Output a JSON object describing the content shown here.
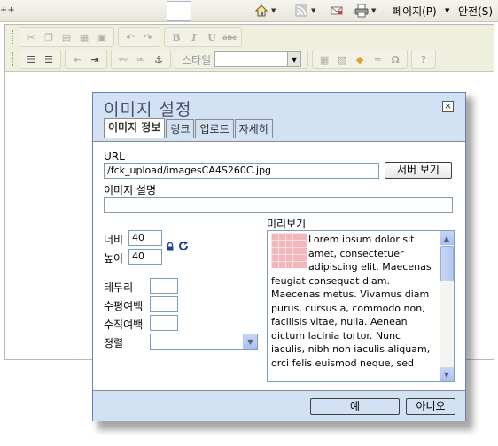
{
  "browser": {
    "left_fragment": "++",
    "page_menu_label": "페이지(P)",
    "safety_menu_label": "안전(S)"
  },
  "editor_toolbar": {
    "style_label": "스타일",
    "style_value": ""
  },
  "dialog": {
    "title": "이미지 설정",
    "tabs": [
      {
        "label": "이미지 정보",
        "active": true
      },
      {
        "label": "링크",
        "active": false
      },
      {
        "label": "업로드",
        "active": false
      },
      {
        "label": "자세히",
        "active": false
      }
    ],
    "url_label": "URL",
    "url_value": "/fck_upload/imagesCA4S260C.jpg",
    "browse_server_label": "서버 보기",
    "alt_label": "이미지 설명",
    "alt_value": "",
    "width_label": "너비",
    "width_value": "40",
    "height_label": "높이",
    "height_value": "40",
    "border_label": "테두리",
    "border_value": "",
    "hspace_label": "수평여백",
    "hspace_value": "",
    "vspace_label": "수직여백",
    "vspace_value": "",
    "align_label": "정렬",
    "align_value": "",
    "preview_label": "미리보기",
    "preview_text": "Lorem ipsum dolor sit amet, consectetuer adipiscing elit. Maecenas feugiat consequat diam. Maecenas metus. Vivamus diam purus, cursus a, commodo non, facilisis vitae, nulla. Aenean dictum lacinia tortor. Nunc iaculis, nibh non iaculis aliquam, orci felis euismod neque, sed",
    "ok_label": "예",
    "cancel_label": "아니오"
  },
  "colors": {
    "dialog_header_bg": "#d3e1f5",
    "dialog_title": "#4a4f6a",
    "toolbar_bg": "#efefde"
  }
}
